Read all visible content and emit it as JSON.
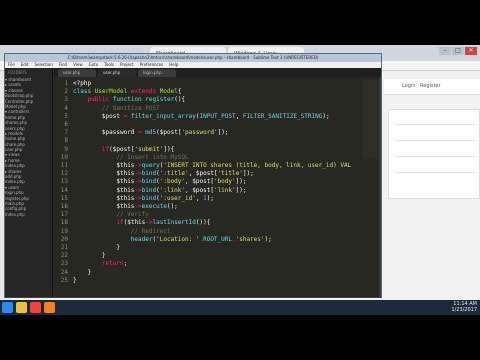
{
  "browser": {
    "tabs": [
      "Shareboard",
      "Windows & Linux..."
    ],
    "site_links": [
      "Login",
      "Register"
    ],
    "window_buttons": [
      "–",
      "□",
      "✕"
    ]
  },
  "editor": {
    "title": "C:\\Bitnami\\wampstack-5.6.26-0\\apache2\\htdocs\\shareboard\\models\\user.php - shareboard - Sublime Text 3 (UNREGISTERED)",
    "menu": [
      "File",
      "Edit",
      "Selection",
      "Find",
      "View",
      "Goto",
      "Tools",
      "Project",
      "Preferences",
      "Help"
    ],
    "tabs": [
      "user.php",
      "user.php",
      "login.php"
    ],
    "active_tab": 1,
    "sidebar_head": "FOLDERS",
    "tree": [
      "▾ shareboard",
      "  ▸ assets",
      "  ▾ classes",
      "     Bootstrap.php",
      "     Controller.php",
      "     Model.php",
      "  ▾ controllers",
      "     home.php",
      "     shares.php",
      "     users.php",
      "  ▸ models",
      "     home.php",
      "     share.php",
      "     user.php",
      "  ▾ views",
      "   ▸ home",
      "     index.php",
      "   ▸ shares",
      "     add.php",
      "     index.php",
      "   ▾ users",
      "     login.php",
      "     register.php",
      "     main.php",
      "  config.php",
      "  index.php"
    ],
    "code": [
      "<?php",
      "class UserModel extends Model{",
      "    public function register(){",
      "        // Sanitize POST",
      "        $post = filter_input_array(INPUT_POST, FILTER_SANITIZE_STRING);",
      "",
      "        $password = md5($post['password']);",
      "",
      "        if($post['submit']){",
      "            // Insert into MySQL",
      "            $this->query('INSERT INTO shares (title, body, link, user_id) VAL",
      "            $this->bind(':title', $post['title']);",
      "            $this->bind(':body', $post['body']);",
      "            $this->bind(':link', $post['link']);",
      "            $this->bind(':user_id', 1);",
      "            $this->execute();",
      "            // Verify",
      "            if($this->lastInsertId()){",
      "                // Redirect",
      "                header('Location: '.ROOT_URL.'shares');",
      "            }",
      "        }",
      "        return;",
      "    }",
      "}"
    ]
  },
  "taskbar": {
    "time": "11:14 AM",
    "date": "1/23/2017"
  },
  "colors": {
    "keyword": "#f92672",
    "function": "#66d9ef",
    "string": "#e6db74",
    "comment": "#75715e",
    "background": "#272822"
  }
}
